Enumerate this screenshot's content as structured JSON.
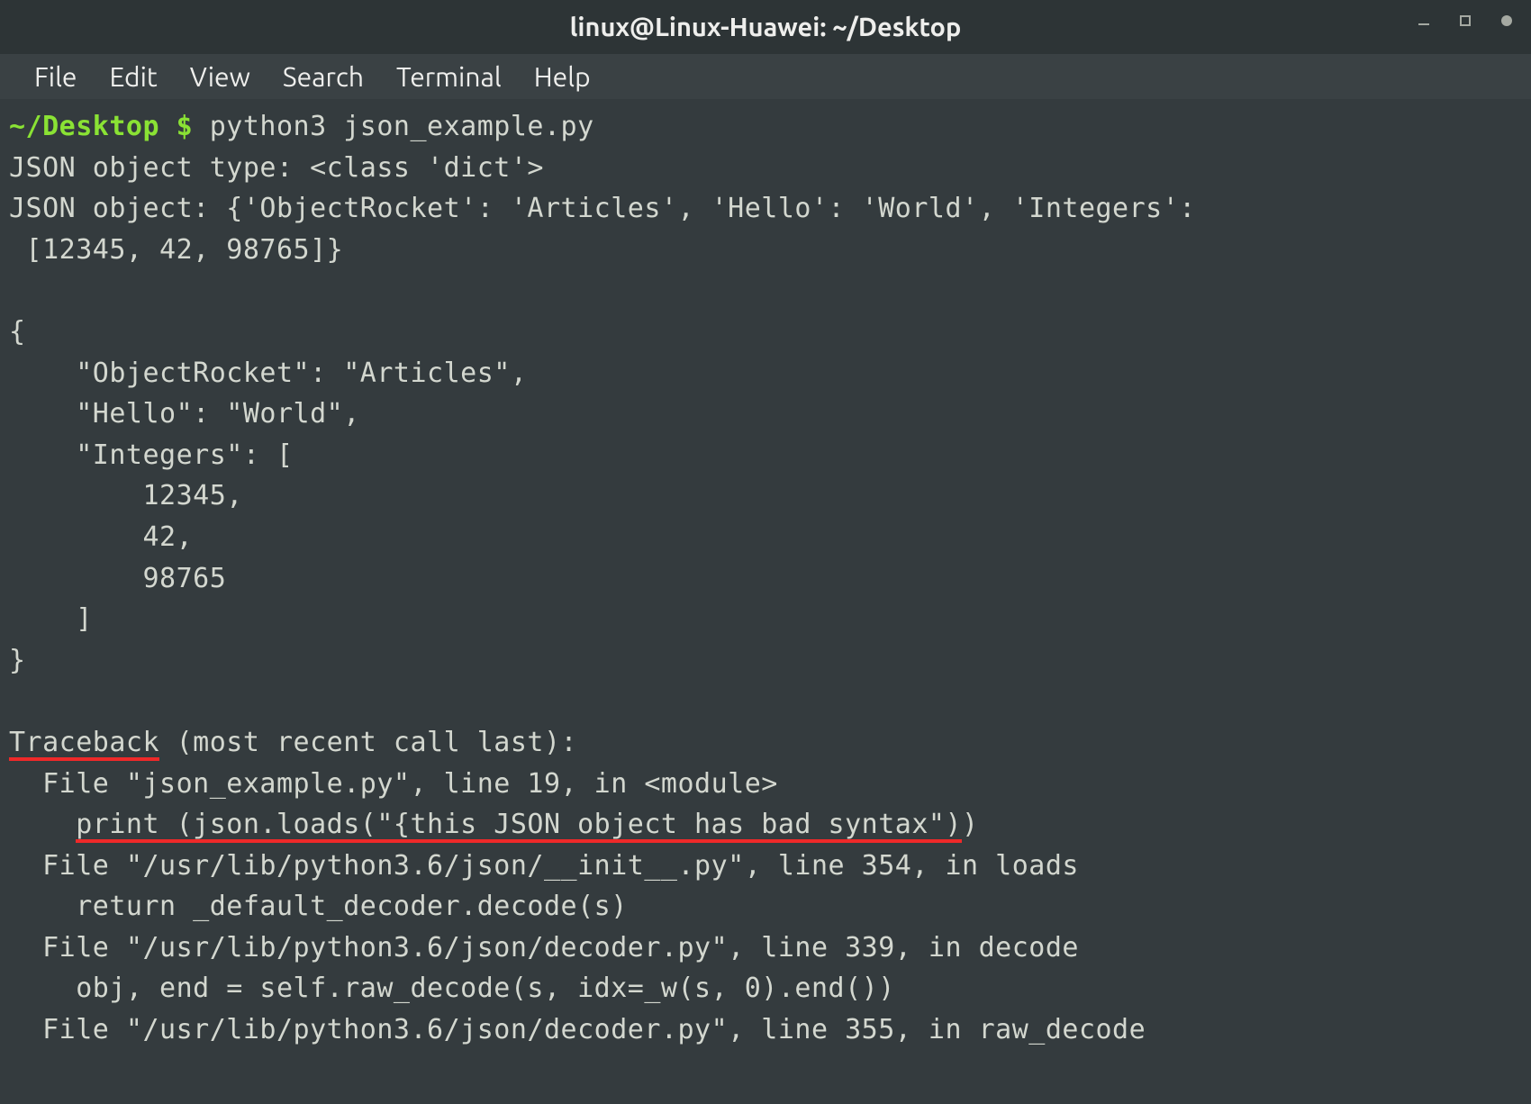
{
  "titlebar": {
    "title": "linux@Linux-Huawei: ~/Desktop"
  },
  "menu": {
    "file": "File",
    "edit": "Edit",
    "view": "View",
    "search": "Search",
    "terminal": "Terminal",
    "help": "Help"
  },
  "prompt": {
    "path": "~/Desktop",
    "dollar": " $ ",
    "command": "python3 json_example.py"
  },
  "output": {
    "line1": "JSON object type: <class 'dict'>",
    "line2": "JSON object: {'ObjectRocket': 'Articles', 'Hello': 'World', 'Integers':",
    "line3": " [12345, 42, 98765]}",
    "blank1": "",
    "json1": "{",
    "json2": "    \"ObjectRocket\": \"Articles\",",
    "json3": "    \"Hello\": \"World\",",
    "json4": "    \"Integers\": [",
    "json5": "        12345,",
    "json6": "        42,",
    "json7": "        98765",
    "json8": "    ]",
    "json9": "}",
    "blank2": "",
    "tb_word": "Traceback",
    "tb_rest": " (most recent call last):",
    "tb1": "  File \"json_example.py\", line 19, in <module>",
    "tb2_pre": "    ",
    "tb2_underlined": "print (json.loads(\"{this JSON object has bad syntax\")",
    "tb2_post": ")",
    "tb3": "  File \"/usr/lib/python3.6/json/__init__.py\", line 354, in loads",
    "tb4": "    return _default_decoder.decode(s)",
    "tb5": "  File \"/usr/lib/python3.6/json/decoder.py\", line 339, in decode",
    "tb6": "    obj, end = self.raw_decode(s, idx=_w(s, 0).end())",
    "tb7": "  File \"/usr/lib/python3.6/json/decoder.py\", line 355, in raw_decode"
  }
}
